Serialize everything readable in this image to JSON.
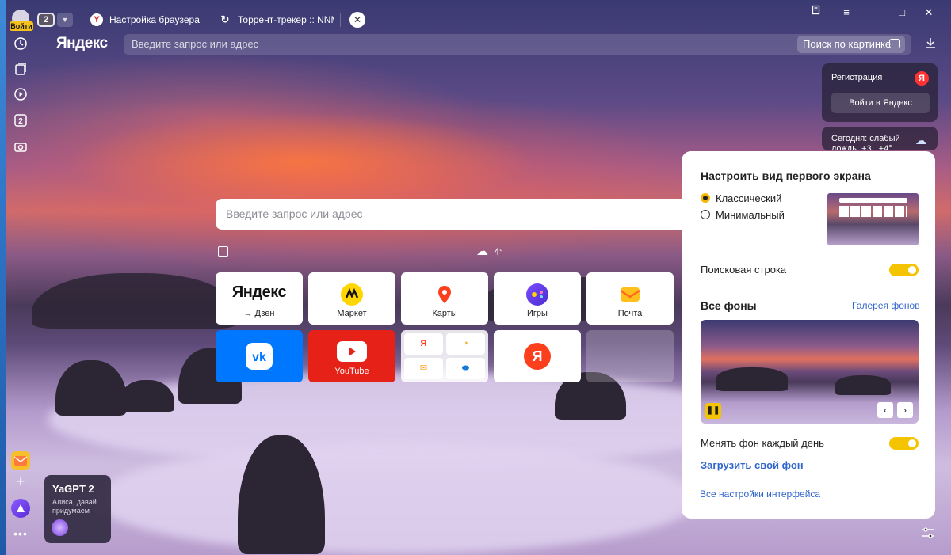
{
  "titlebar": {
    "login_label": "Войти",
    "tab_count": "2",
    "tabs": [
      {
        "label": "Настройка браузера",
        "icon": "yandex-y-icon"
      },
      {
        "label": "Торрент-трекер :: NNM-Club",
        "icon": "loading-icon"
      }
    ]
  },
  "toolbar": {
    "logo": "Яндекс",
    "address_placeholder": "Введите запрос или адрес",
    "image_search_label": "Поиск по картинке"
  },
  "newtab": {
    "search_placeholder": "Введите запрос или адрес",
    "weather": "4°",
    "tiles": [
      {
        "label": "→ Дзен",
        "title": "Яндекс"
      },
      {
        "label": "Маркет"
      },
      {
        "label": "Карты"
      },
      {
        "label": "Игры"
      },
      {
        "label": "Почта"
      },
      {
        "label": ""
      },
      {
        "label": "YouTube"
      },
      {
        "label": ""
      },
      {
        "label": ""
      },
      {
        "label": ""
      }
    ]
  },
  "right_cards": {
    "registration_title": "Регистрация",
    "login_button": "Войти в Яндекс",
    "weather_text_1": "Сегодня: слабый",
    "weather_text_2": "дождь, +3...+4°"
  },
  "yagpt": {
    "title": "YaGPT 2",
    "subtitle_1": "Алиса, давай",
    "subtitle_2": "придумаем"
  },
  "panel": {
    "title": "Настроить вид первого экрана",
    "option_classic": "Классический",
    "option_minimal": "Минимальный",
    "search_bar_label": "Поисковая строка",
    "all_backgrounds": "Все фоны",
    "gallery_link": "Галерея фонов",
    "change_daily_label": "Менять фон каждый день",
    "upload_link": "Загрузить свой фон",
    "all_settings_link": "Все настройки интерфейса"
  },
  "colors": {
    "accent_yellow": "#f5c400",
    "yandex_red": "#fc3f1d",
    "vk_blue": "#0077ff",
    "youtube_red": "#e62117",
    "link_blue": "#3366cc"
  }
}
